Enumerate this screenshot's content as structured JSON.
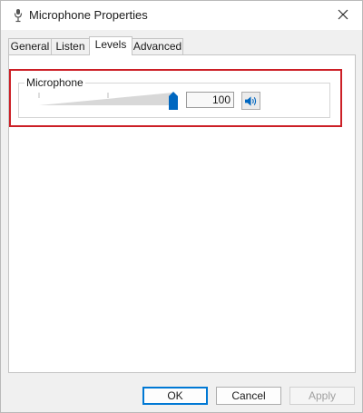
{
  "window": {
    "title": "Microphone Properties",
    "title_icon": "microphone-icon",
    "close_icon": "close-icon"
  },
  "tabs": [
    {
      "label": "General"
    },
    {
      "label": "Listen"
    },
    {
      "label": "Levels",
      "active": true
    },
    {
      "label": "Advanced"
    }
  ],
  "levels": {
    "group_label": "Microphone",
    "level_value": "100",
    "slider_fraction": 1.0,
    "mute_icon": "speaker-icon",
    "highlight_color": "#cc1f26",
    "accent_color": "#0067c0"
  },
  "footer": {
    "ok_label": "OK",
    "cancel_label": "Cancel",
    "apply_label": "Apply"
  }
}
